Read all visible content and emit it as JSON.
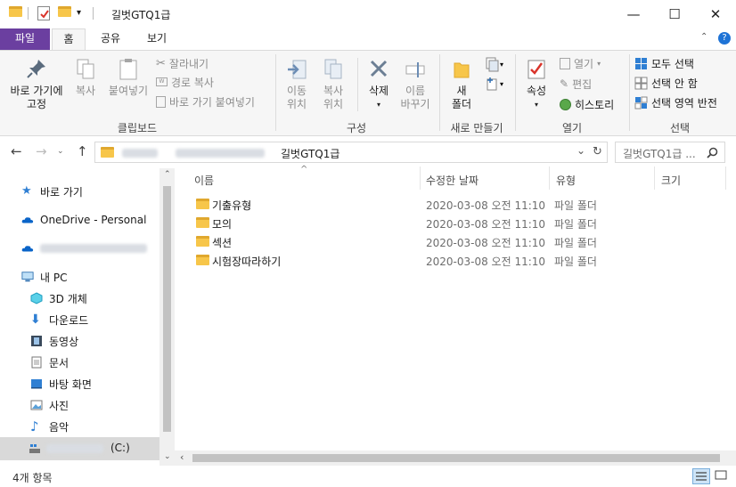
{
  "window": {
    "title": "길벗GTQ1급",
    "controls": {
      "minimize": "—",
      "maximize": "☐",
      "close": "✕"
    }
  },
  "ribbon_tabs": [
    {
      "label": "파일"
    },
    {
      "label": "홈"
    },
    {
      "label": "공유"
    },
    {
      "label": "보기"
    }
  ],
  "ribbon": {
    "clipboard": {
      "pin": "바로 가기에\n고정",
      "copy": "복사",
      "paste": "붙여넣기",
      "cut": "잘라내기",
      "copy_path": "경로 복사",
      "paste_shortcut": "바로 가기 붙여넣기",
      "group": "클립보드"
    },
    "organize": {
      "move": "이동\n위치",
      "copy_to": "복사\n위치",
      "delete": "삭제",
      "rename": "이름\n바꾸기",
      "group": "구성"
    },
    "new": {
      "folder": "새\n폴더",
      "group": "새로 만들기"
    },
    "open": {
      "properties": "속성",
      "open": "열기",
      "edit": "편집",
      "history": "히스토리",
      "group": "열기"
    },
    "select": {
      "select_all": "모두 선택",
      "select_none": "선택 안 함",
      "invert": "선택 영역 반전",
      "group": "선택"
    }
  },
  "address": {
    "current": "길벗GTQ1급",
    "search_placeholder": "길벗GTQ1급 ...",
    "nav": {
      "back": "←",
      "forward": "→",
      "up": "↑",
      "dropdown": "⌄",
      "refresh": "↻"
    }
  },
  "navpane": {
    "quick_access": "바로 가기",
    "onedrive": "OneDrive - Personal",
    "this_pc": "내 PC",
    "items": [
      {
        "label": "3D 개체"
      },
      {
        "label": "다운로드"
      },
      {
        "label": "동영상"
      },
      {
        "label": "문서"
      },
      {
        "label": "바탕 화면"
      },
      {
        "label": "사진"
      },
      {
        "label": "음악"
      }
    ],
    "drive_suffix": "(C:)"
  },
  "columns": {
    "name": "이름",
    "modified": "수정한 날짜",
    "type": "유형",
    "size": "크기"
  },
  "files": [
    {
      "name": "기출유형",
      "modified": "2020-03-08 오전 11:10",
      "type": "파일 폴더"
    },
    {
      "name": "모의",
      "modified": "2020-03-08 오전 11:10",
      "type": "파일 폴더"
    },
    {
      "name": "섹션",
      "modified": "2020-03-08 오전 11:10",
      "type": "파일 폴더"
    },
    {
      "name": "시험장따라하기",
      "modified": "2020-03-08 오전 11:10",
      "type": "파일 폴더"
    }
  ],
  "status": {
    "count": "4개 항목"
  },
  "colors": {
    "file_tab": "#6b3fa0",
    "folder": "#f7c64a",
    "accent": "#0078d7"
  }
}
